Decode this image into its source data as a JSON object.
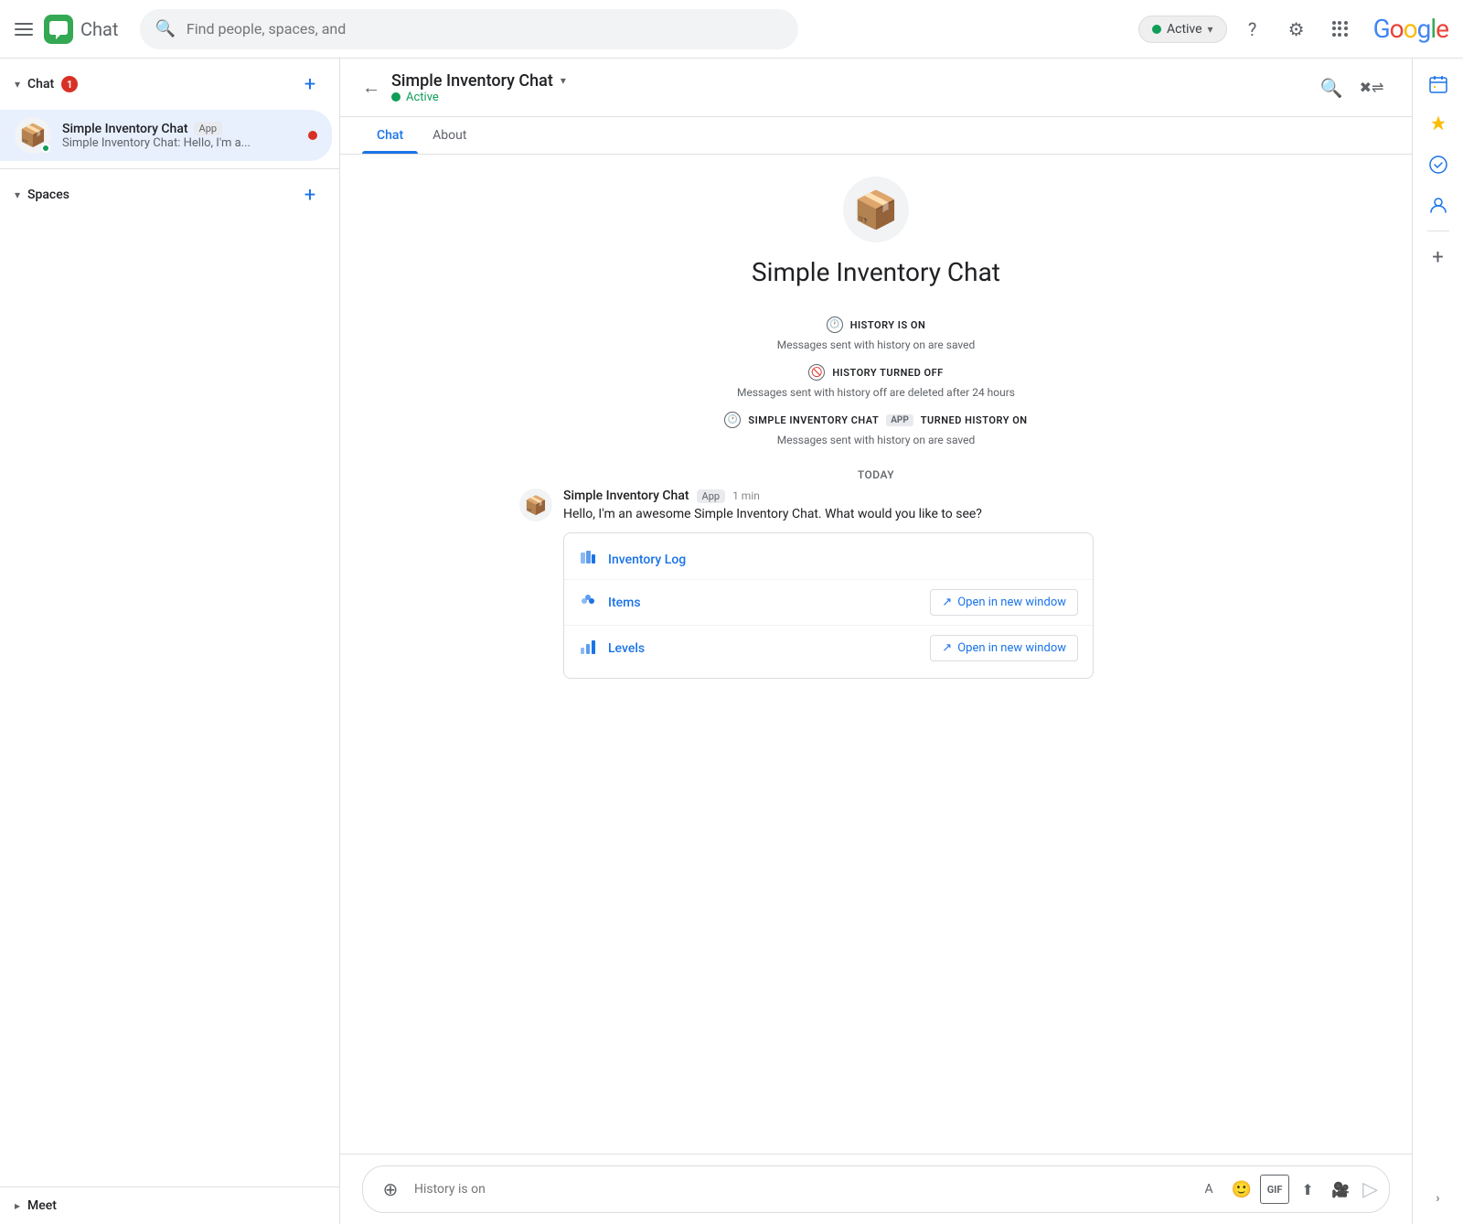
{
  "topNav": {
    "appName": "Chat",
    "searchPlaceholder": "Find people, spaces, and",
    "activeStatus": "Active",
    "helpTitle": "Help",
    "settingsTitle": "Settings",
    "appsTitle": "Google apps",
    "googleLogo": "Google"
  },
  "sidebar": {
    "chatSection": {
      "label": "Chat",
      "badge": "1",
      "addLabel": "+"
    },
    "chatItems": [
      {
        "name": "Simple Inventory Chat",
        "appBadge": "App",
        "preview": "Simple Inventory Chat: Hello, I'm a...",
        "hasUnread": true,
        "hasActiveDot": true,
        "emoji": "📦"
      }
    ],
    "spacesSection": {
      "label": "Spaces",
      "addLabel": "+"
    },
    "meetSection": {
      "label": "Meet"
    }
  },
  "chatHeader": {
    "title": "Simple Inventory Chat",
    "status": "Active",
    "tabs": [
      "Chat",
      "About"
    ],
    "activeTab": 0
  },
  "botIntro": {
    "emoji": "📦",
    "name": "Simple Inventory Chat"
  },
  "historyMessages": [
    {
      "icon": "🕐",
      "label": "HISTORY IS ON",
      "sub": "Messages sent with history on are saved"
    },
    {
      "icon": "🚫",
      "label": "HISTORY TURNED OFF",
      "sub": "Messages sent with history off are deleted after 24 hours"
    },
    {
      "icon": "🕐",
      "label": "SIMPLE INVENTORY CHAT",
      "appBadge": "APP",
      "labelSuffix": "TURNED HISTORY ON",
      "sub": "Messages sent with history on are saved"
    }
  ],
  "todayLabel": "TODAY",
  "message": {
    "sender": "Simple Inventory Chat",
    "appBadge": "App",
    "time": "1 min",
    "text": "Hello, I'm an awesome  Simple Inventory Chat. What would you like to see?",
    "emoji": "📦",
    "card": {
      "rows": [
        {
          "icon": "🏢",
          "label": "Inventory Log",
          "hasOpenBtn": false
        },
        {
          "icon": "🔷",
          "label": "Items",
          "hasOpenBtn": true,
          "openLabel": "Open in new window"
        },
        {
          "icon": "📊",
          "label": "Levels",
          "hasOpenBtn": true,
          "openLabel": "Open in new window"
        }
      ]
    }
  },
  "inputBar": {
    "placeholder": "History is on",
    "addLabel": "⊕"
  },
  "rightSidebar": {
    "items": [
      {
        "icon": "📅",
        "name": "calendar-icon"
      },
      {
        "icon": "🔔",
        "name": "tasks-icon"
      },
      {
        "icon": "✅",
        "name": "checklist-icon"
      },
      {
        "icon": "👤",
        "name": "contacts-icon"
      },
      {
        "icon": "+",
        "name": "add-icon"
      }
    ]
  }
}
